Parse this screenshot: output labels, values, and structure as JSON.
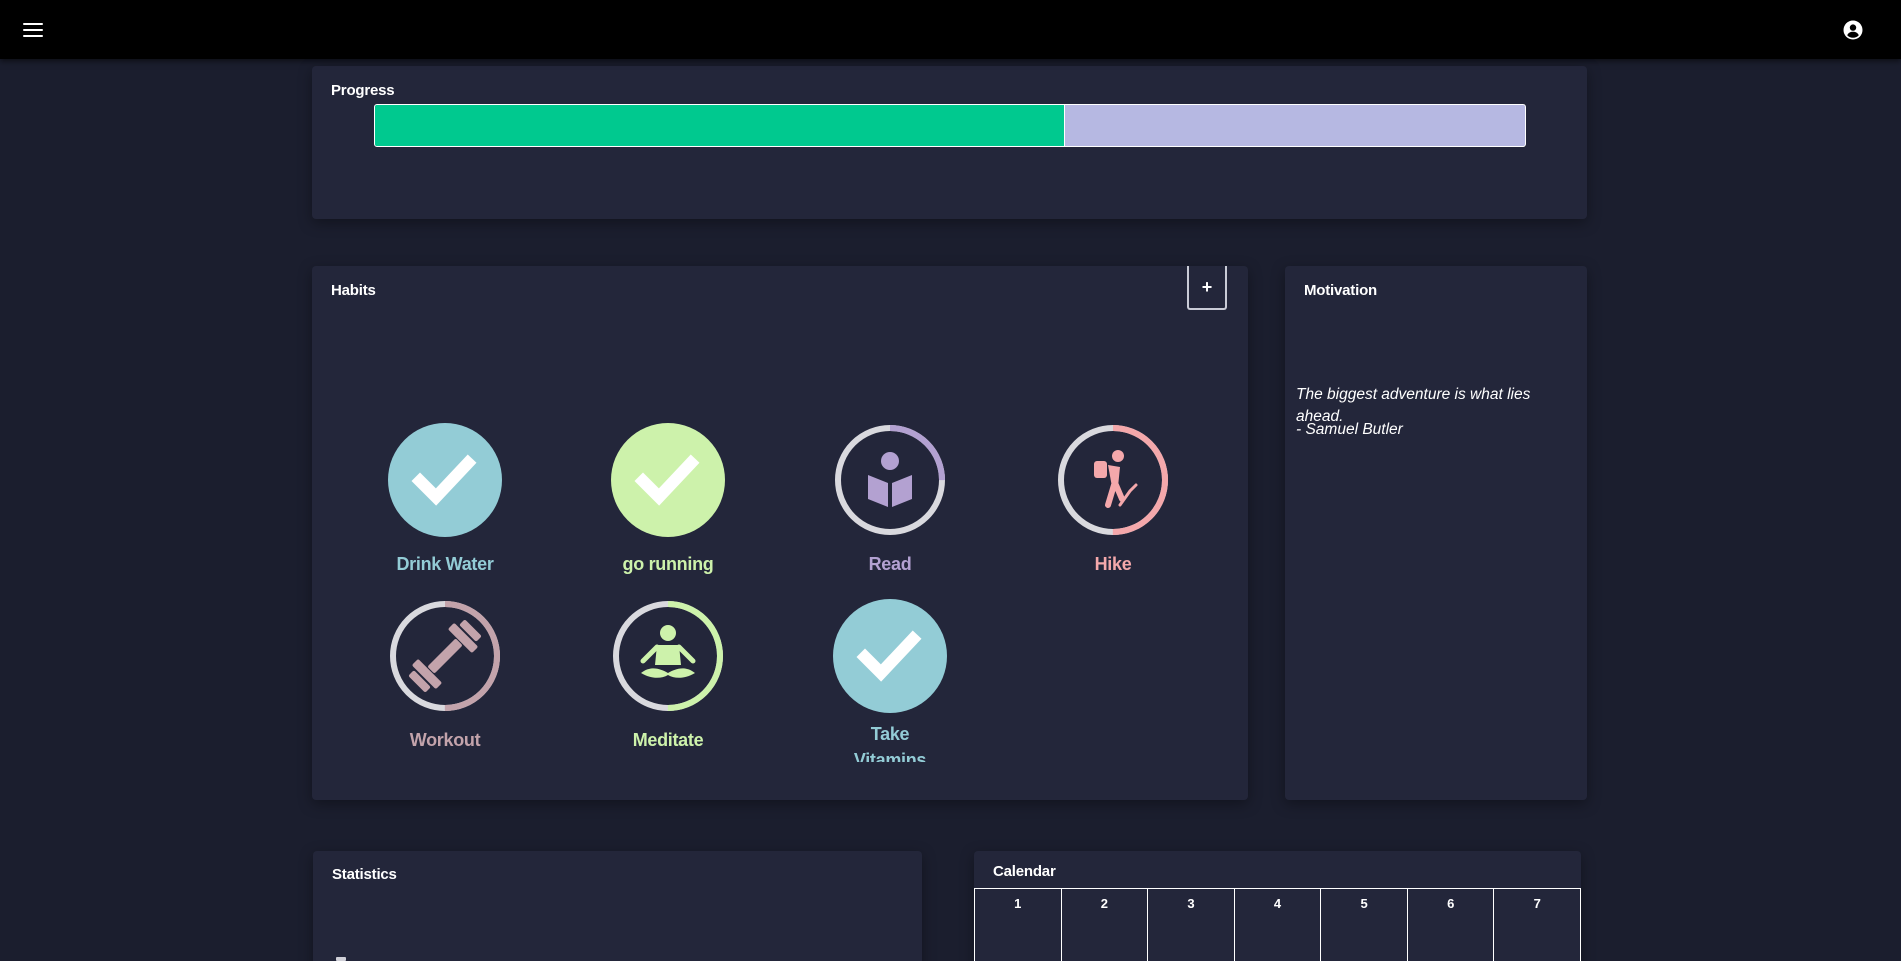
{
  "colors": {
    "background": "#1b1e2e",
    "card": "#23263a",
    "topbar": "#000000",
    "progress_fill": "#00c98f",
    "progress_track": "#b6b8e2",
    "ring_track": "#d9d9de"
  },
  "topbar": {
    "menu_icon": "hamburger-menu-icon",
    "account_icon": "account-circle-icon"
  },
  "progress": {
    "title": "Progress",
    "value_fraction": 0.6
  },
  "habits": {
    "title": "Habits",
    "add_label": "+",
    "items": [
      {
        "name": "Drink Water",
        "color": "#93ccd6",
        "completed": true,
        "progress_fraction": 1.0,
        "icon": "check-icon"
      },
      {
        "name": "go running",
        "color": "#cdf2ab",
        "completed": true,
        "progress_fraction": 1.0,
        "icon": "check-icon"
      },
      {
        "name": "Read",
        "color": "#b3a1d1",
        "completed": false,
        "progress_fraction": 0.25,
        "icon": "reading-person-icon"
      },
      {
        "name": "Hike",
        "color": "#f4a8ab",
        "completed": false,
        "progress_fraction": 0.5,
        "icon": "hiker-icon"
      },
      {
        "name": "Workout",
        "color": "#c3a3ab",
        "completed": false,
        "progress_fraction": 0.5,
        "icon": "dumbbell-icon"
      },
      {
        "name": "Meditate",
        "color": "#cdf2ab",
        "completed": false,
        "progress_fraction": 0.5,
        "icon": "meditation-icon"
      },
      {
        "name": "Take Vitamins",
        "color": "#93ccd6",
        "completed": true,
        "progress_fraction": 1.0,
        "icon": "check-icon"
      }
    ]
  },
  "motivation": {
    "title": "Motivation",
    "quote": "The biggest adventure is what lies ahead.",
    "author": "- Samuel Butler"
  },
  "statistics": {
    "title": "Statistics"
  },
  "calendar": {
    "title": "Calendar",
    "days": [
      "1",
      "2",
      "3",
      "4",
      "5",
      "6",
      "7"
    ]
  }
}
